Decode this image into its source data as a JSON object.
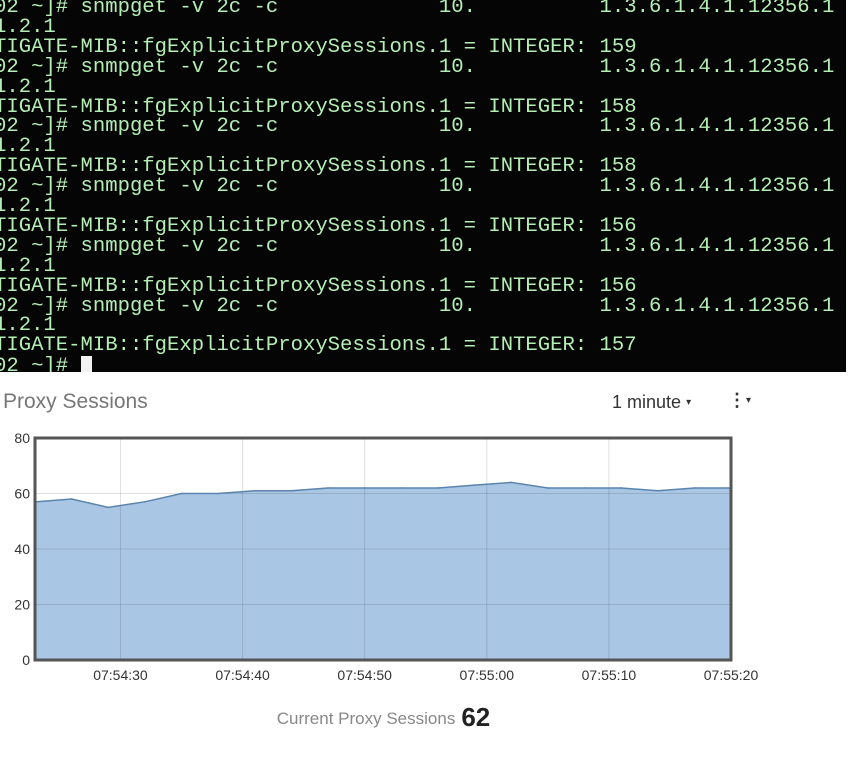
{
  "terminal": {
    "lines": [
      "02 ~]# snmpget -v 2c -c             10.          1.3.6.1.4.1.12356.1",
      "1.2.1",
      "TIGATE-MIB::fgExplicitProxySessions.1 = INTEGER: 159",
      "02 ~]# snmpget -v 2c -c             10.          1.3.6.1.4.1.12356.1",
      "1.2.1",
      "TIGATE-MIB::fgExplicitProxySessions.1 = INTEGER: 158",
      "02 ~]# snmpget -v 2c -c             10.          1.3.6.1.4.1.12356.1",
      "1.2.1",
      "TIGATE-MIB::fgExplicitProxySessions.1 = INTEGER: 158",
      "02 ~]# snmpget -v 2c -c             10.          1.3.6.1.4.1.12356.1",
      "1.2.1",
      "TIGATE-MIB::fgExplicitProxySessions.1 = INTEGER: 156",
      "02 ~]# snmpget -v 2c -c             10.          1.3.6.1.4.1.12356.1",
      "1.2.1",
      "TIGATE-MIB::fgExplicitProxySessions.1 = INTEGER: 156",
      "02 ~]# snmpget -v 2c -c             10.          1.3.6.1.4.1.12356.1",
      "1.2.1",
      "TIGATE-MIB::fgExplicitProxySessions.1 = INTEGER: 157",
      "02 ~]# "
    ]
  },
  "widget": {
    "title": "Proxy Sessions",
    "interval": "1 minute",
    "caret": "▾",
    "menu_icon": "⋮",
    "current_label": "Current Proxy Sessions",
    "current_value": "62"
  },
  "chart_data": {
    "type": "area",
    "title": "Proxy Sessions",
    "xlabel": "",
    "ylabel": "",
    "ylim": [
      0,
      80
    ],
    "yticks": [
      "0",
      "20",
      "40",
      "60",
      "80"
    ],
    "xticks": [
      "07:54:30",
      "07:54:40",
      "07:54:50",
      "07:55:00",
      "07:55:10",
      "07:55:20"
    ],
    "xlim": [
      "07:54:23",
      "07:55:20"
    ],
    "grid": true,
    "fill_color": "#a9c6e4",
    "line_color": "#5b84ad",
    "x": [
      "07:54:23",
      "07:54:26",
      "07:54:29",
      "07:54:32",
      "07:54:35",
      "07:54:38",
      "07:54:41",
      "07:54:44",
      "07:54:47",
      "07:54:50",
      "07:54:53",
      "07:54:56",
      "07:54:59",
      "07:55:02",
      "07:55:05",
      "07:55:08",
      "07:55:11",
      "07:55:14",
      "07:55:17",
      "07:55:20"
    ],
    "values": [
      57,
      58,
      55,
      57,
      60,
      60,
      61,
      61,
      62,
      62,
      62,
      62,
      63,
      64,
      62,
      62,
      62,
      61,
      62,
      62
    ]
  }
}
